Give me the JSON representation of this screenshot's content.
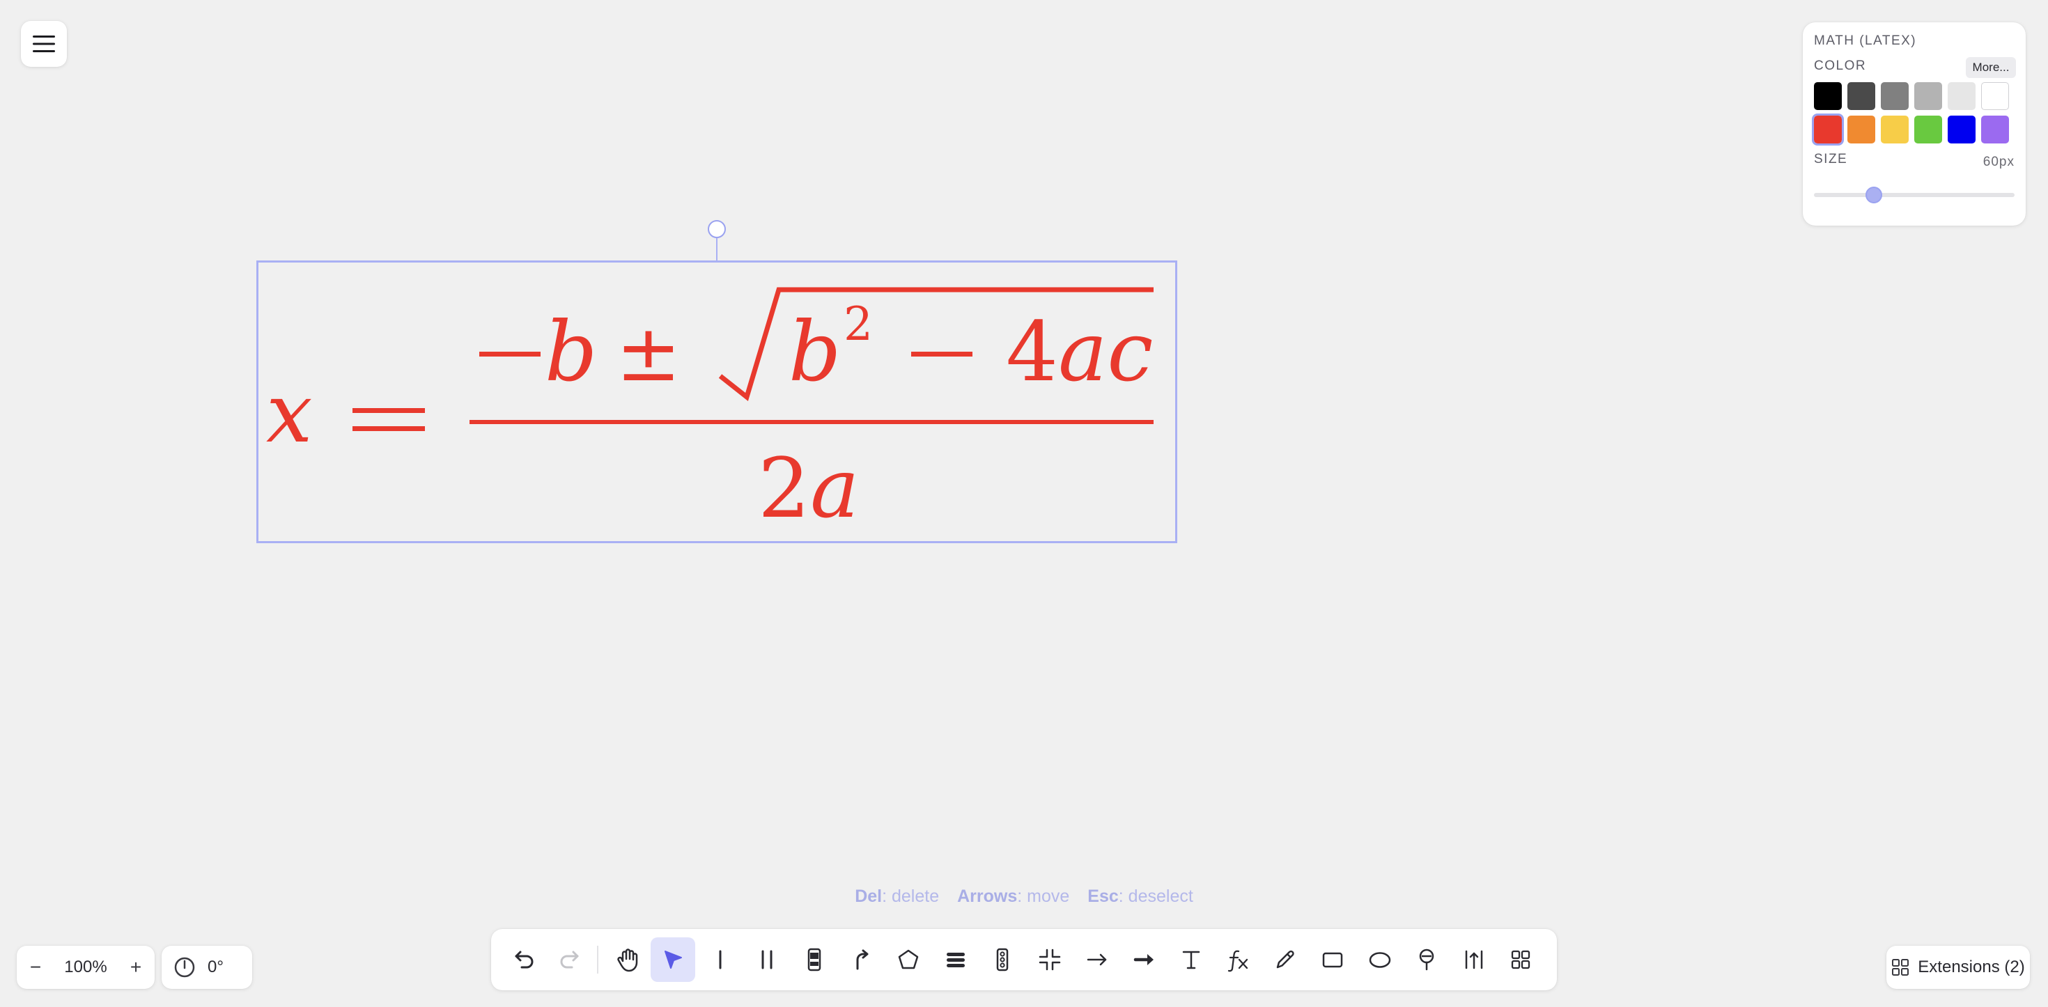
{
  "panel": {
    "title": "MATH (LATEX)",
    "color_label": "COLOR",
    "more_label": "More...",
    "size_label": "SIZE",
    "size_value": "60px",
    "size_slider_fraction": 0.3,
    "swatches_row1": [
      "#000000",
      "#4a4a4a",
      "#808080",
      "#b3b3b3",
      "#e6e6e6",
      "#ffffff"
    ],
    "swatches_row2": [
      "#e8392d",
      "#f08a30",
      "#f7cd48",
      "#69c940",
      "#0000f0",
      "#9b6af0"
    ],
    "selected_color": "#e8392d"
  },
  "formula": {
    "color": "#e8392d"
  },
  "hints": {
    "del_key": "Del",
    "del_action": ": delete",
    "arrows_key": "Arrows",
    "arrows_action": ": move",
    "esc_key": "Esc",
    "esc_action": ": deselect"
  },
  "zoom": {
    "value": "100%",
    "minus": "−",
    "plus": "+"
  },
  "rotation": {
    "value": "0°"
  },
  "toolbar": {
    "tools": [
      "undo-icon",
      "redo-icon",
      "hand-icon",
      "select-icon",
      "line-icon",
      "double-line-icon",
      "phone-icon",
      "curved-arrow-icon",
      "pentagon-icon",
      "stack-icon",
      "traffic-light-icon",
      "compress-icon",
      "arrow-icon",
      "bold-arrow-icon",
      "text-icon",
      "fx-icon",
      "pencil-icon",
      "rectangle-icon",
      "ellipse-icon",
      "pin-icon",
      "measure-icon",
      "grid-icon"
    ],
    "active_tool": "select-icon",
    "fx_label": "fx",
    "text_label": "T"
  },
  "extensions": {
    "label": "Extensions (2)"
  },
  "colors": {
    "accent": "#5b5be6",
    "selection": "#a9b0f4"
  }
}
